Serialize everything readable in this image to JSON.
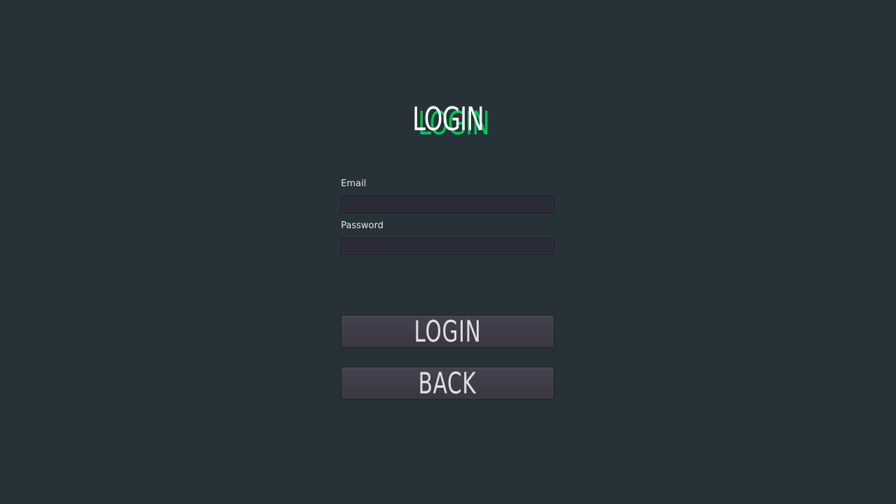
{
  "header": {
    "title": "LOGIN",
    "title_shadow_color": "#00c853",
    "title_color": "#ffffff"
  },
  "form": {
    "email_label": "Email",
    "email_value": "",
    "password_label": "Password",
    "password_value": ""
  },
  "buttons": {
    "login_label": "LOGIN",
    "back_label": "BACK"
  },
  "colors": {
    "background": "#263238",
    "input_background": "#2b2a38",
    "button_background": "#3f3c48"
  }
}
